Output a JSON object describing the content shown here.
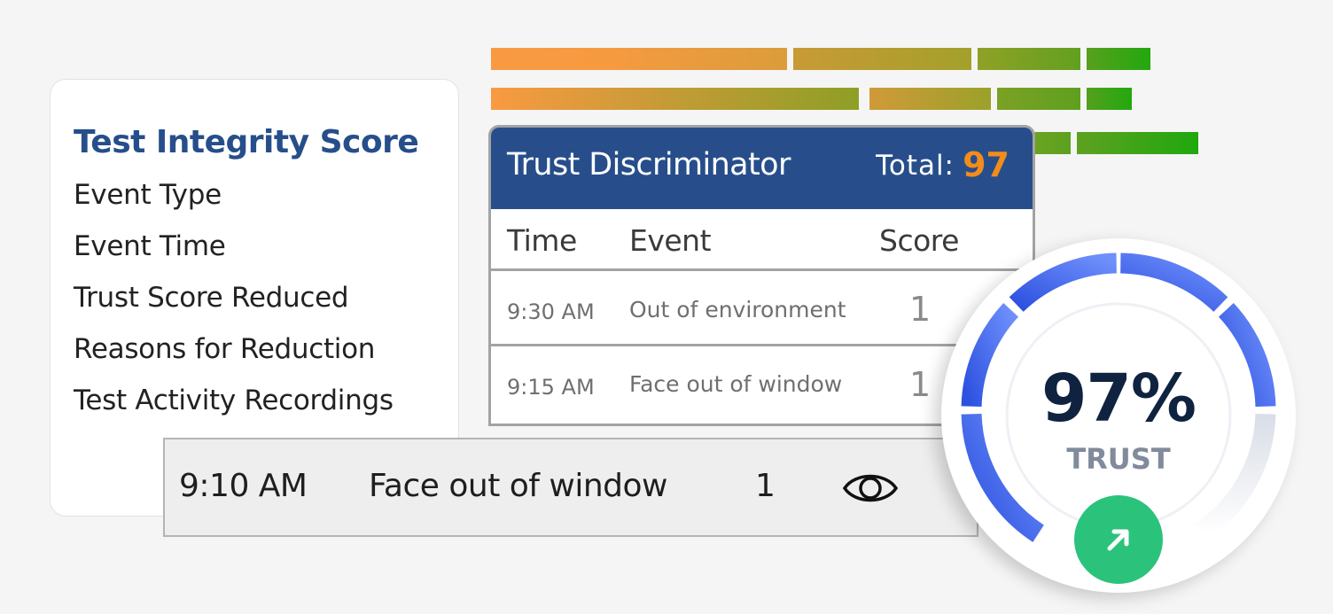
{
  "features": {
    "title": "Test Integrity Score",
    "items": [
      "Event Type",
      "Event Time",
      "Trust Score Reduced",
      "Reasons for Reduction",
      "Test Activity Recordings"
    ]
  },
  "trust_discriminator": {
    "title": "Trust Discriminator",
    "total_label": "Total:",
    "total_value": "97",
    "columns": [
      "Time",
      "Event",
      "Score"
    ],
    "rows": [
      {
        "time": "9:30 AM",
        "event": "Out of environment",
        "score": "1"
      },
      {
        "time": "9:15 AM",
        "event": "Face out of window",
        "score": "1"
      }
    ]
  },
  "highlighted_row": {
    "time": "9:10 AM",
    "event": "Face out of window",
    "score": "1",
    "action_icon": "eye-icon"
  },
  "gauge": {
    "value_text": "97%",
    "label": "TRUST",
    "trust_percent": 97,
    "trend_icon": "arrow-up-right-icon"
  },
  "colors": {
    "brand_blue": "#274e8b",
    "title_blue": "#264e8a",
    "total_orange": "#f28c1a",
    "gauge_blue_dark": "#3155e2",
    "gauge_blue_light": "#6b8bfa",
    "trend_green": "#2bc37b",
    "bar_orange": "#f99a42",
    "bar_green": "#1fa80e"
  }
}
